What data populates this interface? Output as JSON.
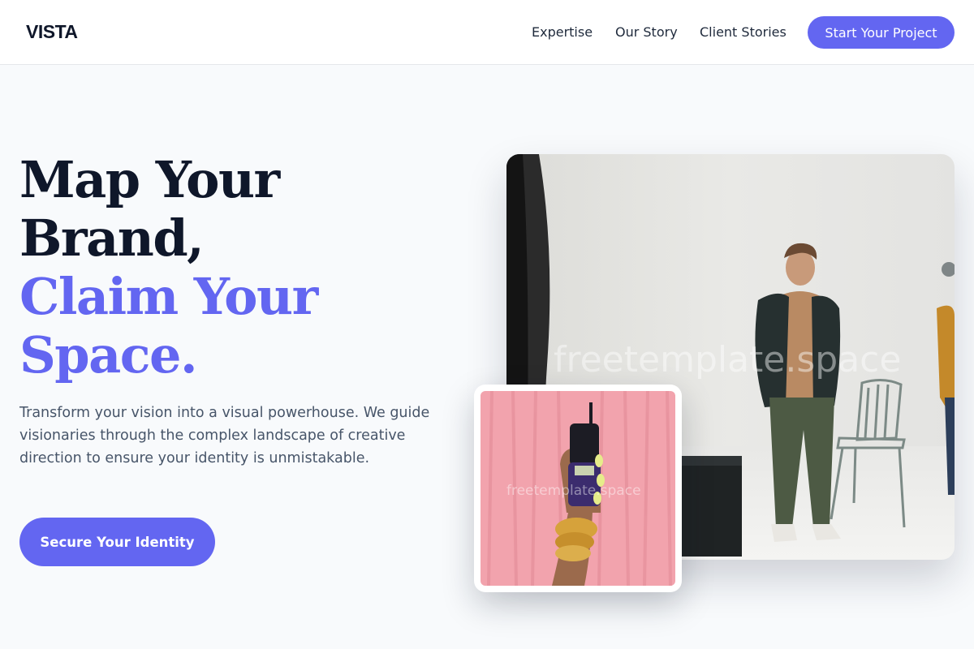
{
  "header": {
    "logo": "VISTA",
    "nav": [
      {
        "label": "Expertise"
      },
      {
        "label": "Our Story"
      },
      {
        "label": "Client Stories"
      }
    ],
    "cta_label": "Start Your Project"
  },
  "hero": {
    "title_lines": [
      "Map Your",
      "Brand,",
      "Claim Your",
      "Space."
    ],
    "subtitle": "Transform your vision into a visual powerhouse. We guide visionaries through the complex landscape of creative direction to ensure your identity is unmistakable.",
    "cta_label": "Secure Your Identity"
  },
  "media": {
    "main_watermark": "freetemplate.space",
    "thumb_watermark": "freetemplate.space"
  },
  "colors": {
    "accent": "#6366f1",
    "heading": "#0f172a",
    "body_text": "#475569",
    "page_bg": "#f8fafc"
  },
  "icons": {
    "main_photo": "man-in-studio-photo",
    "thumb_photo": "hand-holding-phone-photo"
  }
}
